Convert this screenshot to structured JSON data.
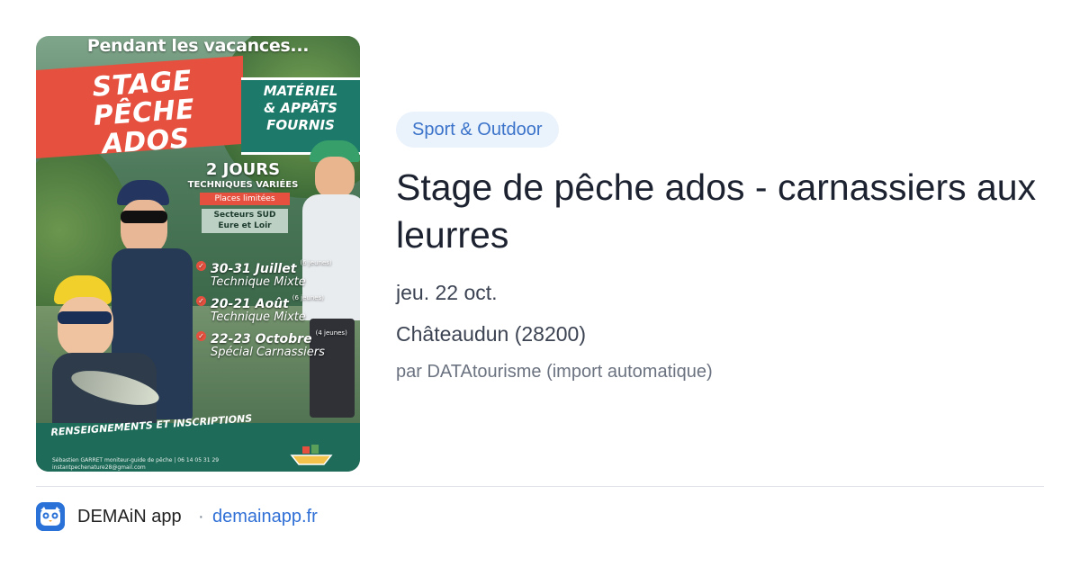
{
  "poster": {
    "top_text": "Pendant les vacances...",
    "title_line1": "STAGE PÊCHE",
    "title_line2": "ADOS",
    "materiel_line1": "MATÉRIEL",
    "materiel_line2": "& APPÂTS",
    "materiel_line3": "FOURNIS",
    "days": "2 JOURS",
    "techniques": "TECHNIQUES VARIÉES",
    "places": "Places limitées",
    "secteurs_line1": "Secteurs SUD",
    "secteurs_line2": "Eure et Loir",
    "dates": [
      {
        "date": "30-31 Juillet",
        "note": "(6 jeunes)",
        "type": "Technique Mixte"
      },
      {
        "date": "20-21 Août",
        "note": "(6 jeunes)",
        "type": "Technique Mixte"
      },
      {
        "date": "22-23 Octobre",
        "note": "(4 jeunes)",
        "type": "Spécial Carnassiers"
      }
    ],
    "renseignements": "RENSEIGNEMENTS ET INSCRIPTIONS",
    "contact_line1": "Sébastien GARRET  moniteur-guide de pêche  |  06 14 05 31 29",
    "contact_line2": "instantpechenature28@gmail.com"
  },
  "category": "Sport & Outdoor",
  "title": "Stage de pêche ados - carnassiers aux leurres",
  "date": "jeu. 22 oct.",
  "location": "Châteaudun (28200)",
  "source": "par DATAtourisme (import automatique)",
  "footer": {
    "app_name": "DEMAiN app",
    "separator": "·",
    "url": "demainapp.fr"
  },
  "colors": {
    "accent": "#2f6fd6",
    "category_bg": "#eaf2fc",
    "poster_red": "#e5503f",
    "poster_teal": "#1d7a6a"
  },
  "icons": {
    "app": "owl-app-icon",
    "check": "check-icon"
  }
}
